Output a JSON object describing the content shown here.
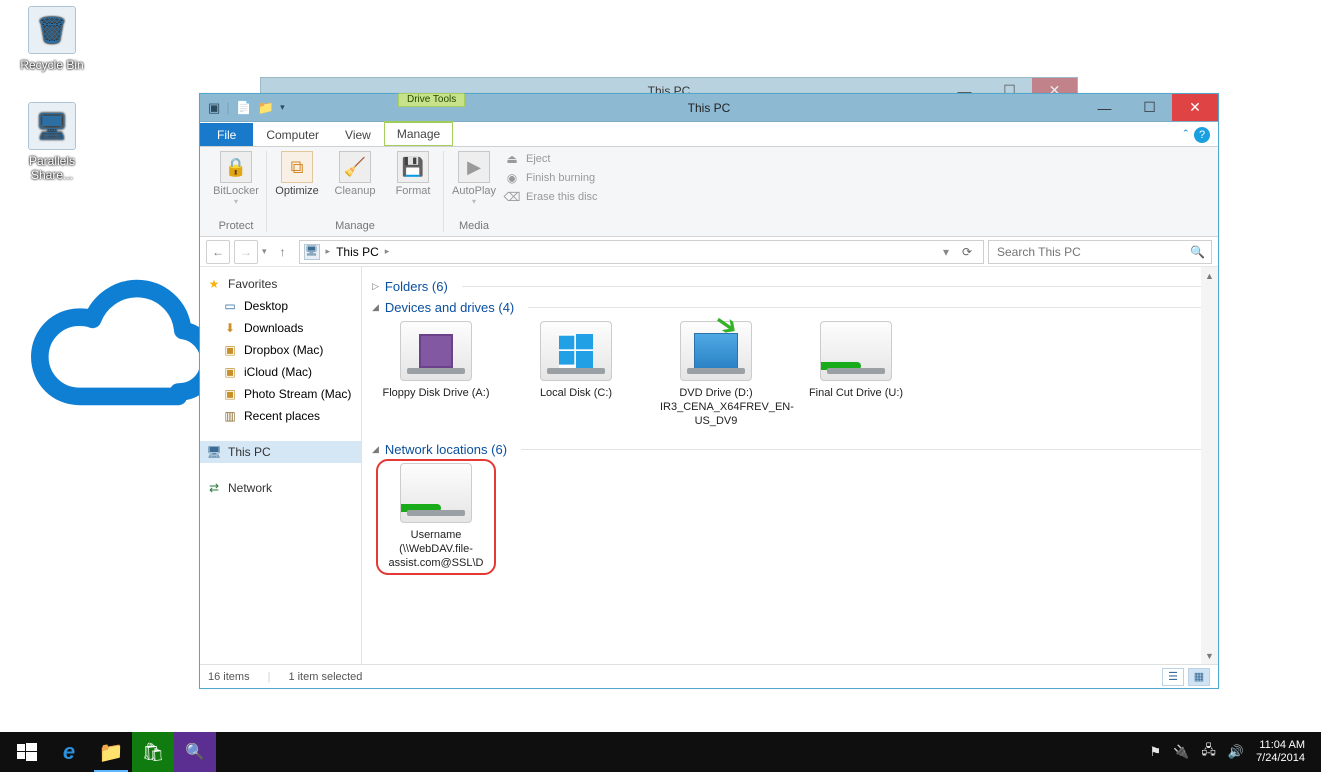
{
  "desktop": {
    "icons": [
      {
        "name": "recycle-bin",
        "label": "Recycle Bin"
      },
      {
        "name": "parallels-share",
        "label": "Parallels Share..."
      }
    ]
  },
  "bg_window": {
    "title": "This PC"
  },
  "window": {
    "title": "This PC",
    "drive_tools_chip": "Drive Tools",
    "tabs": {
      "file": "File",
      "computer": "Computer",
      "view": "View",
      "manage": "Manage"
    },
    "ribbon": {
      "protect": {
        "bitlocker": "BitLocker",
        "title": "Protect"
      },
      "manage": {
        "optimize": "Optimize",
        "cleanup": "Cleanup",
        "format": "Format",
        "title": "Manage"
      },
      "media": {
        "autoplay": "AutoPlay",
        "eject": "Eject",
        "finish": "Finish burning",
        "erase": "Erase this disc",
        "title": "Media"
      }
    },
    "address": {
      "location": "This PC",
      "refresh_glyph": "⟳",
      "dropdown_glyph": "▾"
    },
    "search": {
      "placeholder": "Search This PC"
    },
    "nav": {
      "favorites": {
        "label": "Favorites",
        "items": {
          "desktop": "Desktop",
          "downloads": "Downloads",
          "dropbox": "Dropbox (Mac)",
          "icloud": "iCloud (Mac)",
          "photostream": "Photo Stream (Mac)",
          "recent": "Recent places"
        }
      },
      "thispc": "This PC",
      "network": "Network"
    },
    "content": {
      "folders_head": "Folders (6)",
      "devices_head": "Devices and drives (4)",
      "network_head": "Network locations (6)",
      "drives": {
        "floppy": "Floppy Disk Drive (A:)",
        "local": "Local Disk (C:)",
        "dvd": "DVD Drive (D:) IR3_CENA_X64FREV_EN-US_DV9",
        "final": "Final Cut Drive (U:)"
      },
      "network_item": {
        "line1": "Username",
        "line2": "(\\\\WebDAV.file-assist.com@SSL\\D"
      }
    },
    "status": {
      "items": "16 items",
      "selected": "1 item selected"
    }
  },
  "taskbar": {
    "clock": {
      "time": "11:04 AM",
      "date": "7/24/2014"
    }
  }
}
